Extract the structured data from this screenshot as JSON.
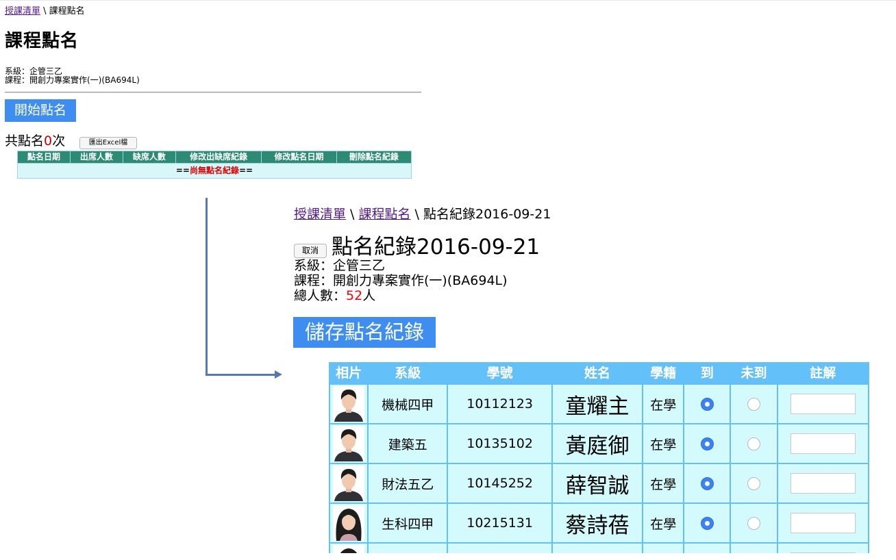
{
  "left_page": {
    "breadcrumb": {
      "link": "授課清單",
      "sep": " \\ ",
      "current": "課程點名"
    },
    "title": "課程點名",
    "dept_line": "系級：企管三乙",
    "course_line": "課程：開創力專案實作(一)(BA694L)",
    "start_button": "開始點名",
    "count": {
      "prefix": "共點名",
      "number": "0",
      "suffix": "次"
    },
    "excel_button": "匯出Excel檔",
    "table": {
      "headers": [
        "點名日期",
        "出席人數",
        "缺席人數",
        "修改出缺席紀錄",
        "修改點名日期",
        "刪除點名紀錄"
      ],
      "empty_pre": "==",
      "empty_text": "尚無點名紀錄",
      "empty_post": "=="
    }
  },
  "right_page": {
    "breadcrumb": {
      "link1": "授課清單",
      "sep1": " \\ ",
      "link2": "課程點名",
      "sep2": " \\ ",
      "current": "點名紀錄2016-09-21"
    },
    "cancel_button": "取消",
    "title": "點名紀錄2016-09-21",
    "dept_line": "系級：企管三乙",
    "course_line": "課程：開創力專案實作(一)(BA694L)",
    "total": {
      "prefix": "總人數：",
      "number": "52",
      "suffix": "人"
    },
    "save_button": "儲存點名紀錄",
    "headers": [
      "相片",
      "系級",
      "學號",
      "姓名",
      "學籍",
      "到",
      "未到",
      "註解"
    ],
    "students": [
      {
        "dept": "機械四甲",
        "id": "10112123",
        "name": "童耀主",
        "status": "在學",
        "present": true,
        "photo": "male-student-photo"
      },
      {
        "dept": "建築五",
        "id": "10135102",
        "name": "黃庭御",
        "status": "在學",
        "present": true,
        "photo": "male-student-photo"
      },
      {
        "dept": "財法五乙",
        "id": "10145252",
        "name": "薛智誠",
        "status": "在學",
        "present": true,
        "photo": "male-student-photo"
      },
      {
        "dept": "生科四甲",
        "id": "10215131",
        "name": "蔡詩蓓",
        "status": "在學",
        "present": true,
        "photo": "female-student-photo"
      }
    ]
  },
  "colors": {
    "button_blue": "#3d8ef0",
    "table_header_green": "#2e8b73",
    "table_header_blue": "#63c0f8",
    "cell_bg": "#d3fbfe",
    "highlight_red": "#ff0000",
    "link_purple": "#551a8b",
    "arrow": "#5577b8"
  }
}
